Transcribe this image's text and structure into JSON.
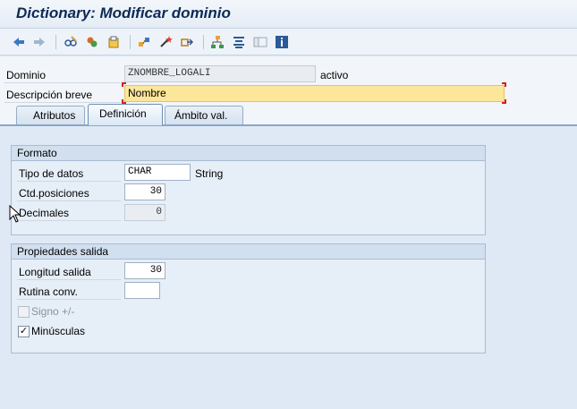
{
  "window": {
    "title": "Dictionary: Modificar dominio"
  },
  "toolbar": {
    "icons": [
      "back-arrow-icon",
      "forward-arrow-icon",
      "display-change-icon",
      "activate-icon",
      "check-icon",
      "where-used-icon",
      "magic-wand-icon",
      "navigate-icon",
      "hierarchy-icon",
      "list-icon",
      "layout-icon",
      "info-icon"
    ]
  },
  "header": {
    "dominio_label": "Dominio",
    "dominio_value": "ZNOMBRE_LOGALI",
    "status": "activo",
    "descripcion_label": "Descripción breve",
    "descripcion_value": "Nombre"
  },
  "tabs": [
    {
      "label": "Atributos",
      "active": false
    },
    {
      "label": "Definición",
      "active": true
    },
    {
      "label": "Ámbito val.",
      "active": false
    }
  ],
  "formato": {
    "title": "Formato",
    "tipo_label": "Tipo de datos",
    "tipo_value": "CHAR",
    "tipo_desc": "String",
    "posiciones_label": "Ctd.posiciones",
    "posiciones_value": "30",
    "decimales_label": "Decimales",
    "decimales_value": "0"
  },
  "propiedades": {
    "title": "Propiedades salida",
    "longitud_label": "Longitud salida",
    "longitud_value": "30",
    "rutina_label": "Rutina conv.",
    "rutina_value": "",
    "signo_label": "Signo +/-",
    "signo_checked": false,
    "minusculas_label": "Minúsculas",
    "minusculas_checked": true
  },
  "colors": {
    "background": "#dfe9f5",
    "title_text": "#0c2a55",
    "required_field": "#fbe69a",
    "required_marker": "#d62020"
  }
}
